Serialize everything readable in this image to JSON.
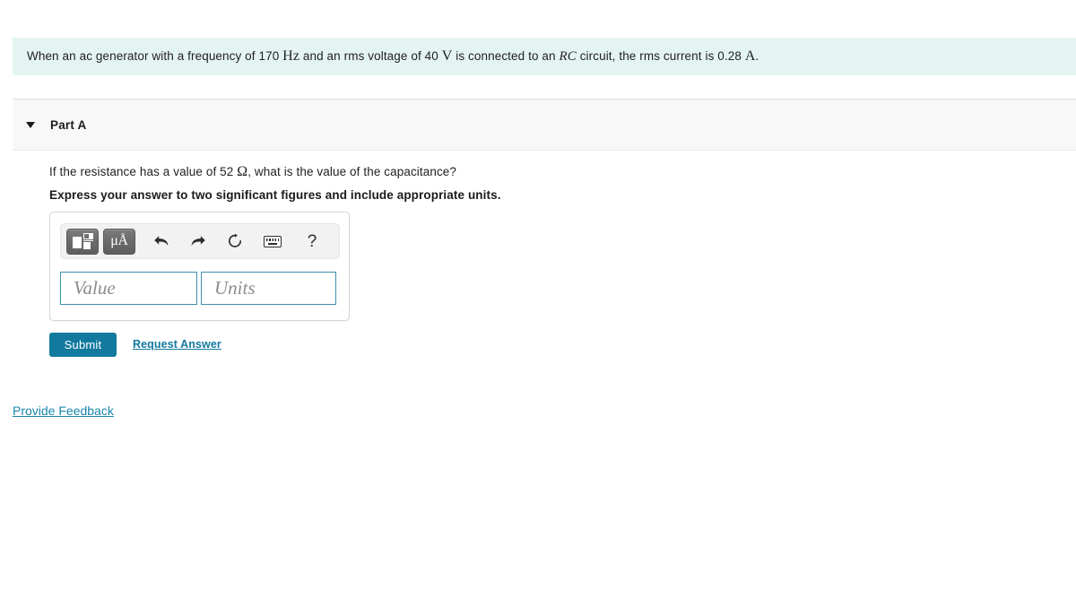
{
  "problem": {
    "text_part1": "When an ac generator with a frequency of 170 ",
    "unit_hz": "Hz",
    "text_part2": " and an rms voltage of 40 ",
    "unit_v": "V",
    "text_part3": " is connected to an ",
    "circuit_label": "RC",
    "text_part4": " circuit, the rms current is 0.28 ",
    "unit_a": "A",
    "text_part5": ".",
    "background_color": "#e4f4f3"
  },
  "part": {
    "title": "Part A",
    "caret_icon": "caret-down-icon",
    "expanded": true
  },
  "question": {
    "prompt_part1": "If the resistance has a value of 52 ",
    "unit_ohm": "Ω",
    "prompt_part2": ", what is the value of the capacitance?",
    "instruction": "Express your answer to two significant figures and include appropriate units."
  },
  "answer_widget": {
    "toolbar": {
      "template_button": {
        "name": "template-icon",
        "label": ""
      },
      "units_button": {
        "name": "micro-angstrom-icon",
        "label": "μÅ"
      },
      "undo": "⬆",
      "undo_glyph": "↶",
      "redo_glyph": "↷",
      "reset_glyph": "↻",
      "keyboard_label": "keyboard-icon",
      "help_glyph": "?"
    },
    "value_field": {
      "placeholder": "Value",
      "value": ""
    },
    "units_field": {
      "placeholder": "Units",
      "value": ""
    }
  },
  "actions": {
    "submit_label": "Submit",
    "request_answer_label": "Request Answer",
    "submit_color": "#12799f"
  },
  "footer": {
    "feedback_label": "Provide Feedback",
    "link_color": "#1a84ad"
  }
}
